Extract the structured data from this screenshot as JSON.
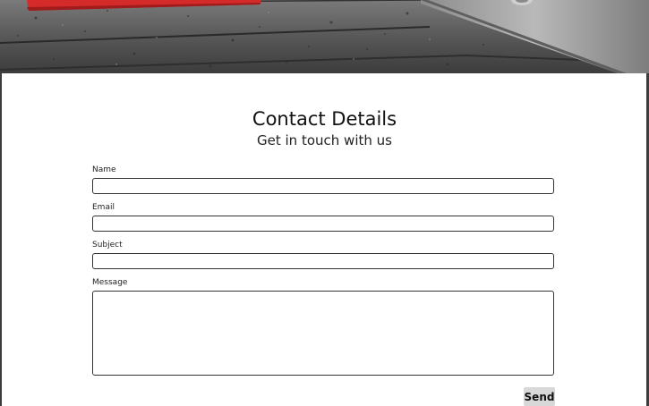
{
  "contact": {
    "title": "Contact Details",
    "subtitle": "Get in touch with us",
    "fields": {
      "name_label": "Name",
      "name_value": "",
      "email_label": "Email",
      "email_value": "",
      "subject_label": "Subject",
      "subject_value": "",
      "message_label": "Message",
      "message_value": ""
    },
    "send_label": "Send"
  },
  "colors": {
    "accent_red": "#d42a2a",
    "text": "#111111",
    "button_bg": "#d8d8d8"
  }
}
